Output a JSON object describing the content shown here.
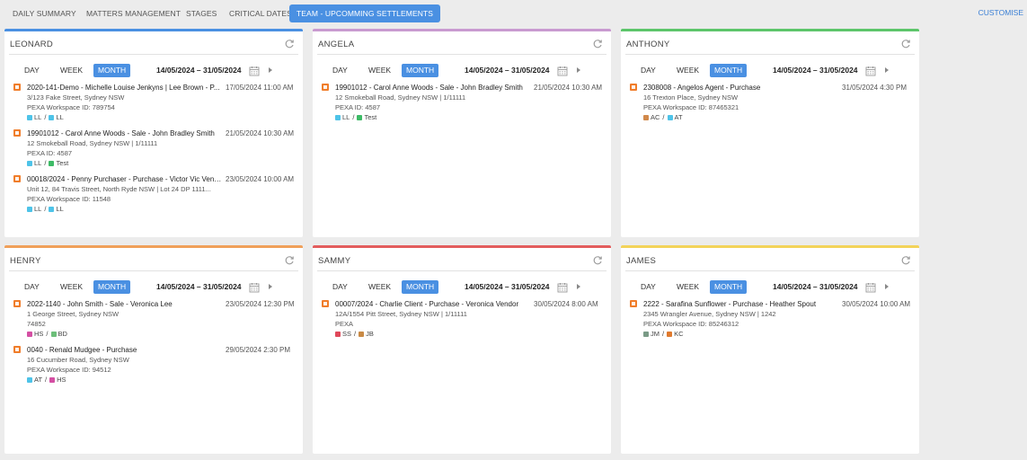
{
  "nav": {
    "tabs": [
      {
        "label": "DAILY SUMMARY"
      },
      {
        "label": "MATTERS MANAGEMENT"
      },
      {
        "label": "STAGES"
      },
      {
        "label": "CRITICAL DATES"
      },
      {
        "label": "TEAM - UPCOMMING SETTLEMENTS"
      }
    ],
    "customise": "CUSTOMISE"
  },
  "colors": {
    "accent": "#4a90e2",
    "matter_icon": "#f07d2a",
    "card_borders": [
      "#4a90e2",
      "#c99ad0",
      "#5cc56a",
      "#f0a05a",
      "#e35d5d",
      "#f3d35a"
    ]
  },
  "controls": {
    "day": "DAY",
    "week": "WEEK",
    "month": "MONTH",
    "daterange": "14/05/2024 – 31/05/2024"
  },
  "cards": [
    {
      "name": "LEONARD",
      "items": [
        {
          "title": "2020-141-Demo - Michelle Louise Jenkyns | Lee Brown - P...",
          "date": "17/05/2024 11:00 AM",
          "lines": [
            "3/123 Fake Street, Sydney NSW",
            "PEXA Workspace ID: 789754"
          ],
          "tags": [
            {
              "code": "LL",
              "color": "#4ec3e8"
            },
            {
              "code": "LL",
              "color": "#4ec3e8"
            }
          ]
        },
        {
          "title": "19901012 - Carol Anne Woods - Sale - John Bradley Smith",
          "date": "21/05/2024 10:30 AM",
          "lines": [
            "12 Smokeball Road, Sydney NSW | 1/11111",
            "PEXA ID: 4587"
          ],
          "tags": [
            {
              "code": "LL",
              "color": "#4ec3e8"
            },
            {
              "code": "Test",
              "color": "#3dbb66"
            }
          ]
        },
        {
          "title": "00018/2024 - Penny Purchaser - Purchase - Victor Vic Vend...",
          "date": "23/05/2024 10:00 AM",
          "lines": [
            "Unit 12, 84 Travis Street, North Ryde NSW | Lot 24 DP 1111...",
            "PEXA Workspace ID: 11548"
          ],
          "tags": [
            {
              "code": "LL",
              "color": "#4ec3e8"
            },
            {
              "code": "LL",
              "color": "#4ec3e8"
            }
          ]
        }
      ]
    },
    {
      "name": "ANGELA",
      "items": [
        {
          "title": "19901012 - Carol Anne Woods - Sale - John Bradley Smith",
          "date": "21/05/2024 10:30 AM",
          "lines": [
            "12 Smokeball Road, Sydney NSW | 1/11111",
            "PEXA ID: 4587"
          ],
          "tags": [
            {
              "code": "LL",
              "color": "#4ec3e8"
            },
            {
              "code": "Test",
              "color": "#3dbb66"
            }
          ]
        }
      ]
    },
    {
      "name": "ANTHONY",
      "items": [
        {
          "title": "2308008 - Angelos Agent - Purchase",
          "date": "31/05/2024 4:30 PM",
          "lines": [
            "16 Trexton Place, Sydney NSW",
            "PEXA Workspace ID: 87465321"
          ],
          "tags": [
            {
              "code": "AC",
              "color": "#d1894b"
            },
            {
              "code": "AT",
              "color": "#4ec3e8"
            }
          ]
        }
      ]
    },
    {
      "name": "HENRY",
      "items": [
        {
          "title": "2022-1140 - John Smith - Sale - Veronica Lee",
          "date": "23/05/2024 12:30 PM",
          "lines": [
            "1 George Street, Sydney NSW",
            "74852"
          ],
          "tags": [
            {
              "code": "HS",
              "color": "#d44fa3"
            },
            {
              "code": "BD",
              "color": "#6dbf7a"
            }
          ]
        },
        {
          "title": "0040 - Renald Mudgee - Purchase",
          "date": "29/05/2024 2:30 PM",
          "lines": [
            "16 Cucumber Road, Sydney NSW",
            "PEXA Workspace ID: 94512"
          ],
          "tags": [
            {
              "code": "AT",
              "color": "#4ec3e8"
            },
            {
              "code": "HS",
              "color": "#d44fa3"
            }
          ]
        }
      ]
    },
    {
      "name": "SAMMY",
      "items": [
        {
          "title": "00007/2024 - Charlie Client - Purchase - Veronica Vendor",
          "date": "30/05/2024 8:00 AM",
          "lines": [
            "12A/1554 Pitt Street, Sydney NSW | 1/11111",
            "PEXA"
          ],
          "tags": [
            {
              "code": "SS",
              "color": "#e0485a"
            },
            {
              "code": "JB",
              "color": "#c98a45"
            }
          ]
        }
      ]
    },
    {
      "name": "JAMES",
      "items": [
        {
          "title": "2222 - Sarafina Sunflower - Purchase - Heather Spout",
          "date": "30/05/2024 10:00 AM",
          "lines": [
            "2345 Wrangler Avenue, Sydney NSW | 1242",
            "PEXA Workspace ID: 85246312"
          ],
          "tags": [
            {
              "code": "JM",
              "color": "#7a9a86"
            },
            {
              "code": "KC",
              "color": "#e07a2e"
            }
          ]
        }
      ]
    }
  ]
}
